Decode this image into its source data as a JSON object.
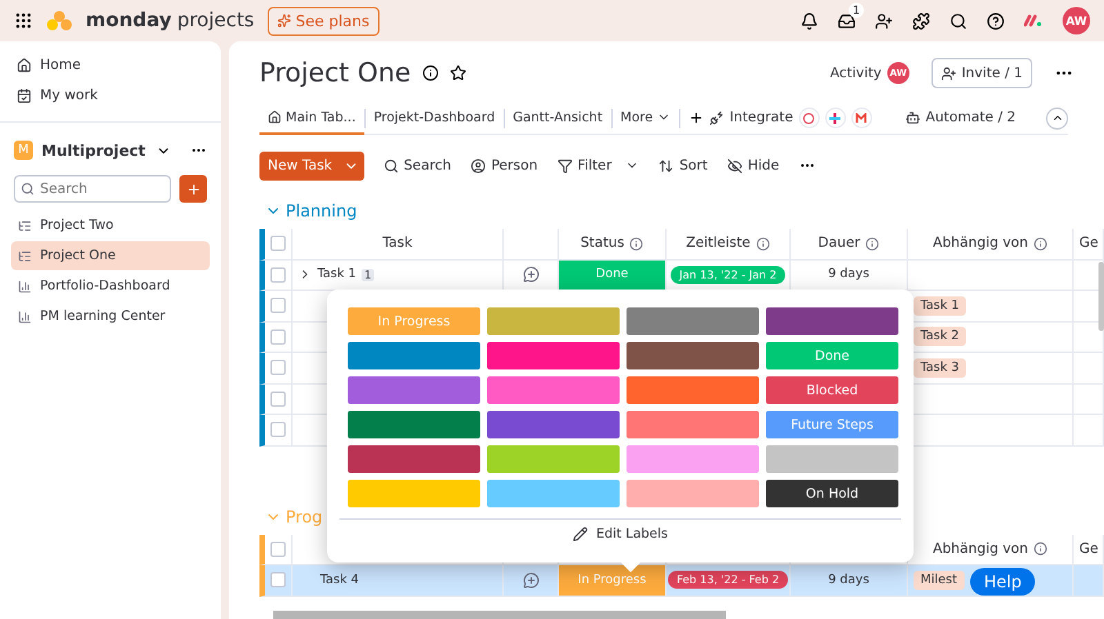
{
  "topbar": {
    "brand": "monday",
    "brand_suffix": "projects",
    "see_plans": "See plans",
    "inbox_badge": "1",
    "avatar": "AW"
  },
  "sidebar": {
    "nav": [
      {
        "label": "Home",
        "kind": "home"
      },
      {
        "label": "My work",
        "kind": "work"
      }
    ],
    "workspace": {
      "initial": "M",
      "name": "Multiproject"
    },
    "search": {
      "placeholder": "Search"
    },
    "boards": [
      {
        "label": "Project Two",
        "kind": "board",
        "selected": false
      },
      {
        "label": "Project One",
        "kind": "board",
        "selected": true
      },
      {
        "label": "Portfolio-Dashboard",
        "kind": "dashboard",
        "selected": false
      },
      {
        "label": "PM learning Center",
        "kind": "dashboard",
        "selected": false
      }
    ]
  },
  "board": {
    "title": "Project One",
    "activity": "Activity",
    "activity_avatar": "AW",
    "invite": "Invite / 1",
    "tabs": [
      {
        "label": "Main Tab...",
        "kind": "home",
        "selected": true
      },
      {
        "label": "Projekt-Dashboard",
        "kind": "view",
        "selected": false
      },
      {
        "label": "Gantt-Ansicht",
        "kind": "view",
        "selected": false
      },
      {
        "label": "More",
        "kind": "more",
        "selected": false
      }
    ],
    "integrate": "Integrate",
    "automate": "Automate / 2",
    "new_item": "New Task",
    "actions": [
      {
        "label": "Search",
        "kind": "search"
      },
      {
        "label": "Person",
        "kind": "person"
      },
      {
        "label": "Filter",
        "kind": "filter"
      },
      {
        "label": "Sort",
        "kind": "sort"
      },
      {
        "label": "Hide",
        "kind": "hide"
      }
    ]
  },
  "groups": [
    {
      "title": "Planning",
      "color": "#0086c0",
      "columns": {
        "task": "Task",
        "status": "Status",
        "timeline": "Zeitleiste",
        "duration": "Dauer",
        "depends": "Abhängig von",
        "col_6": "Ge"
      },
      "rows": [
        {
          "name": "Task 1",
          "subitems": "1",
          "status": {
            "label": "Done",
            "color": "#00c875"
          },
          "timeline": {
            "label": "Jan 13, '22 - Jan 2",
            "color": "#00c875"
          },
          "duration": "9 days",
          "selected": false
        },
        {
          "depends": "Task 1",
          "selected": false
        },
        {
          "depends": "Task 2",
          "selected": false
        },
        {
          "depends": "Task 3",
          "selected": false
        },
        {
          "selected": false
        },
        {
          "selected": false
        }
      ]
    },
    {
      "title": "Prog",
      "color": "#fdab3d",
      "columns": {
        "depends": "Abhängig von",
        "col_6": "Ge"
      },
      "rows": [
        {
          "name": "Task 4",
          "status": {
            "label": "In Progress",
            "color": "#fdab3d"
          },
          "timeline": {
            "label": "Feb 13, '22 - Feb 2",
            "color": "#e2445c"
          },
          "duration": "9 days",
          "depends": "Milest",
          "selected": true
        }
      ]
    }
  ],
  "status_picker": {
    "labels": [
      {
        "color": "#fdab3d",
        "label": "In Progress"
      },
      {
        "color": "#c9b641"
      },
      {
        "color": "#808080"
      },
      {
        "color": "#7e3b8a"
      },
      {
        "color": "#0086c0"
      },
      {
        "color": "#ff158a"
      },
      {
        "color": "#7f5347"
      },
      {
        "color": "#00c875",
        "label": "Done"
      },
      {
        "color": "#a25ddc"
      },
      {
        "color": "#ff5ac4"
      },
      {
        "color": "#ff642e"
      },
      {
        "color": "#e2445c",
        "label": "Blocked"
      },
      {
        "color": "#037f4c"
      },
      {
        "color": "#784bd1"
      },
      {
        "color": "#ff7575"
      },
      {
        "color": "#579bfc",
        "label": "Future Steps"
      },
      {
        "color": "#bb3354"
      },
      {
        "color": "#9cd326"
      },
      {
        "color": "#faa1f1"
      },
      {
        "color": "#c4c4c4"
      },
      {
        "color": "#ffcb00"
      },
      {
        "color": "#66ccff"
      },
      {
        "color": "#ffadad"
      },
      {
        "color": "#333333",
        "label": "On Hold"
      }
    ],
    "edit": "Edit Labels"
  },
  "help": "Help"
}
